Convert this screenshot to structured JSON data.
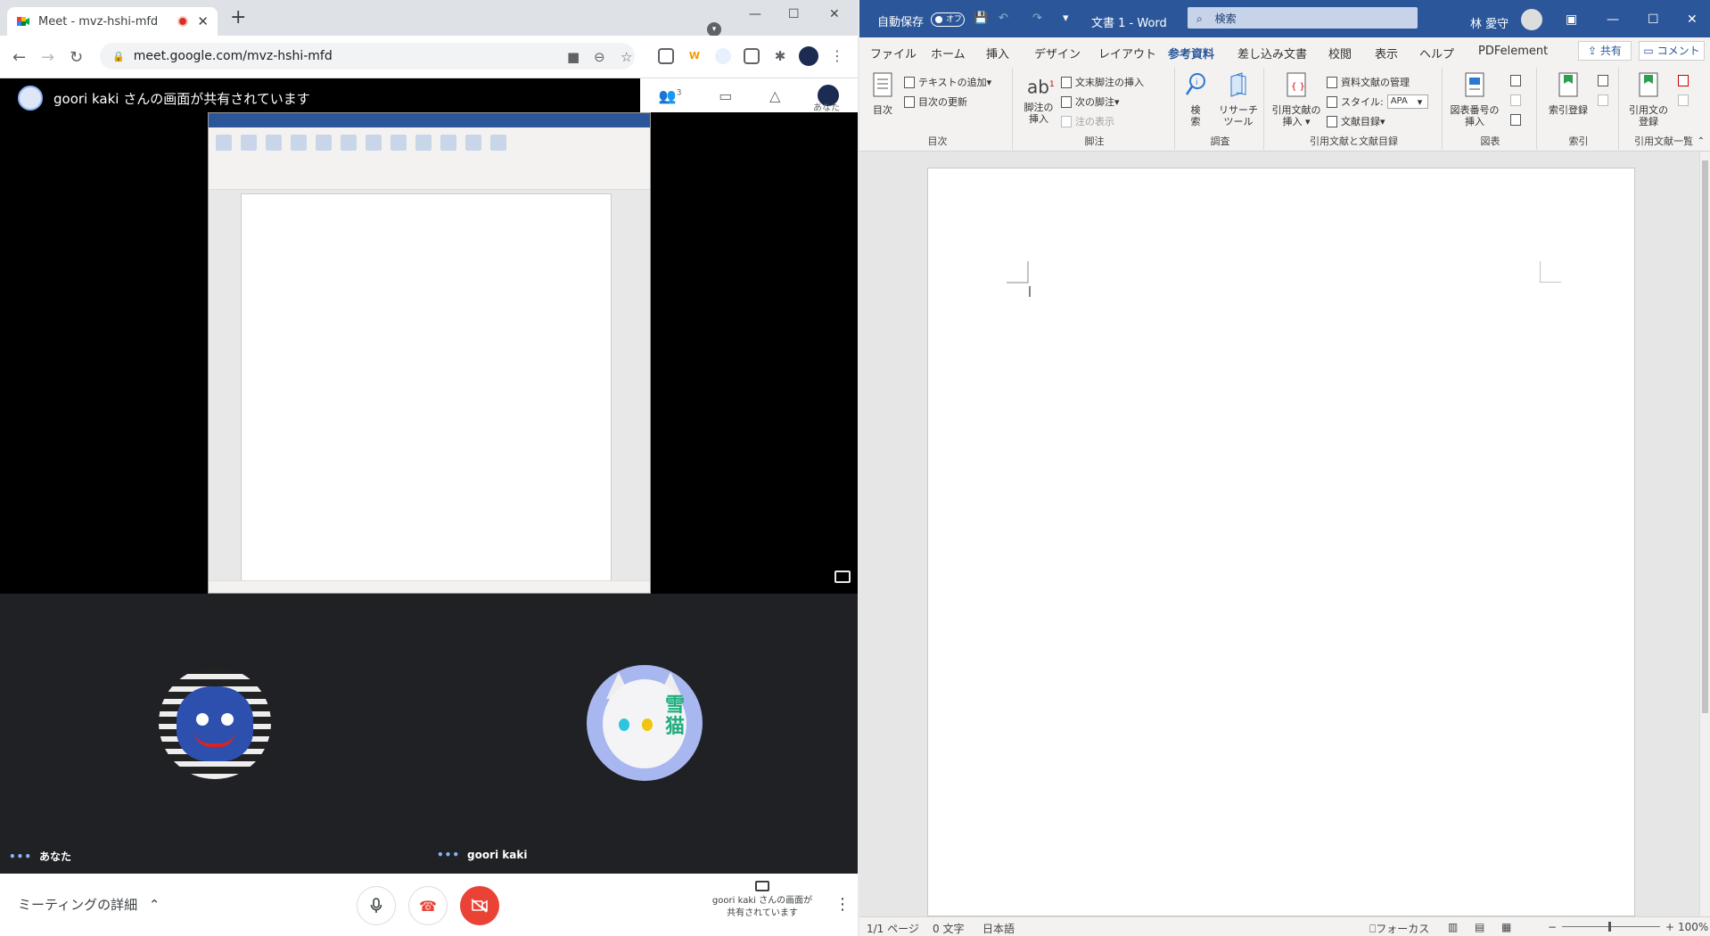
{
  "chrome": {
    "tab_title": "Meet - mvz-hshi-mfd",
    "new_tab": "+",
    "url": "meet.google.com/mvz-hshi-mfd",
    "window_controls": [
      "—",
      "☐",
      "✕"
    ]
  },
  "meet": {
    "share_banner": "goori kaki さんの画面が共有されています",
    "people_count": "3",
    "you_label": "あなた",
    "participants": [
      {
        "name": "あなた",
        "dots": "•••"
      },
      {
        "name": "goori kaki",
        "dots": "•••"
      }
    ],
    "avatar_kanji": "雪猫",
    "meeting_details": "ミーティングの詳細",
    "presenting_line1": "goori kaki さんの画面が",
    "presenting_line2": "共有されています"
  },
  "word": {
    "autosave": "自動保存",
    "autosave_state": "オフ",
    "doc_title": "文書 1 - Word",
    "search_placeholder": "検索",
    "user_name": "林 愛守",
    "menu": [
      "ファイル",
      "ホーム",
      "挿入",
      "デザイン",
      "レイアウト",
      "参考資料",
      "差し込み文書",
      "校閲",
      "表示",
      "ヘルプ",
      "PDFelement"
    ],
    "active_menu": "参考資料",
    "share": "共有",
    "comment": "コメント",
    "ribbon": {
      "toc_big": "目次",
      "toc_add_text": "テキストの追加",
      "toc_update": "目次の更新",
      "toc_group": "目次",
      "footnote_big_1": "脚注の",
      "footnote_big_2": "挿入",
      "endnote_insert": "文末脚注の挿入",
      "next_footnote": "次の脚注",
      "show_notes": "注の表示",
      "footnote_group": "脚注",
      "search_big": "検",
      "search_big2": "索",
      "research_1": "リサーチ",
      "research_2": "ツール",
      "research_group": "調査",
      "cite_insert_1": "引用文献の",
      "cite_insert_2": "挿入",
      "manage_sources": "資料文献の管理",
      "style_label": "スタイル:",
      "style_value": "APA",
      "bibliography": "文献目録",
      "citation_group": "引用文献と文献目録",
      "caption_1": "図表番号の",
      "caption_2": "挿入",
      "caption_group": "図表",
      "mark_entry": "索引登録",
      "index_group": "索引",
      "mark_citation_1": "引用文の",
      "mark_citation_2": "登録",
      "toa_group": "引用文献一覧"
    },
    "status": {
      "page": "1/1 ページ",
      "words": "0 文字",
      "language": "日本語",
      "focus": "フォーカス",
      "zoom": "100%",
      "zoom_minus": "−",
      "zoom_plus": "+"
    }
  },
  "colors": {
    "word_blue": "#2b579a",
    "meet_dark": "#202124",
    "hangup_red": "#ea4335",
    "cam_off_red": "#d93025"
  }
}
